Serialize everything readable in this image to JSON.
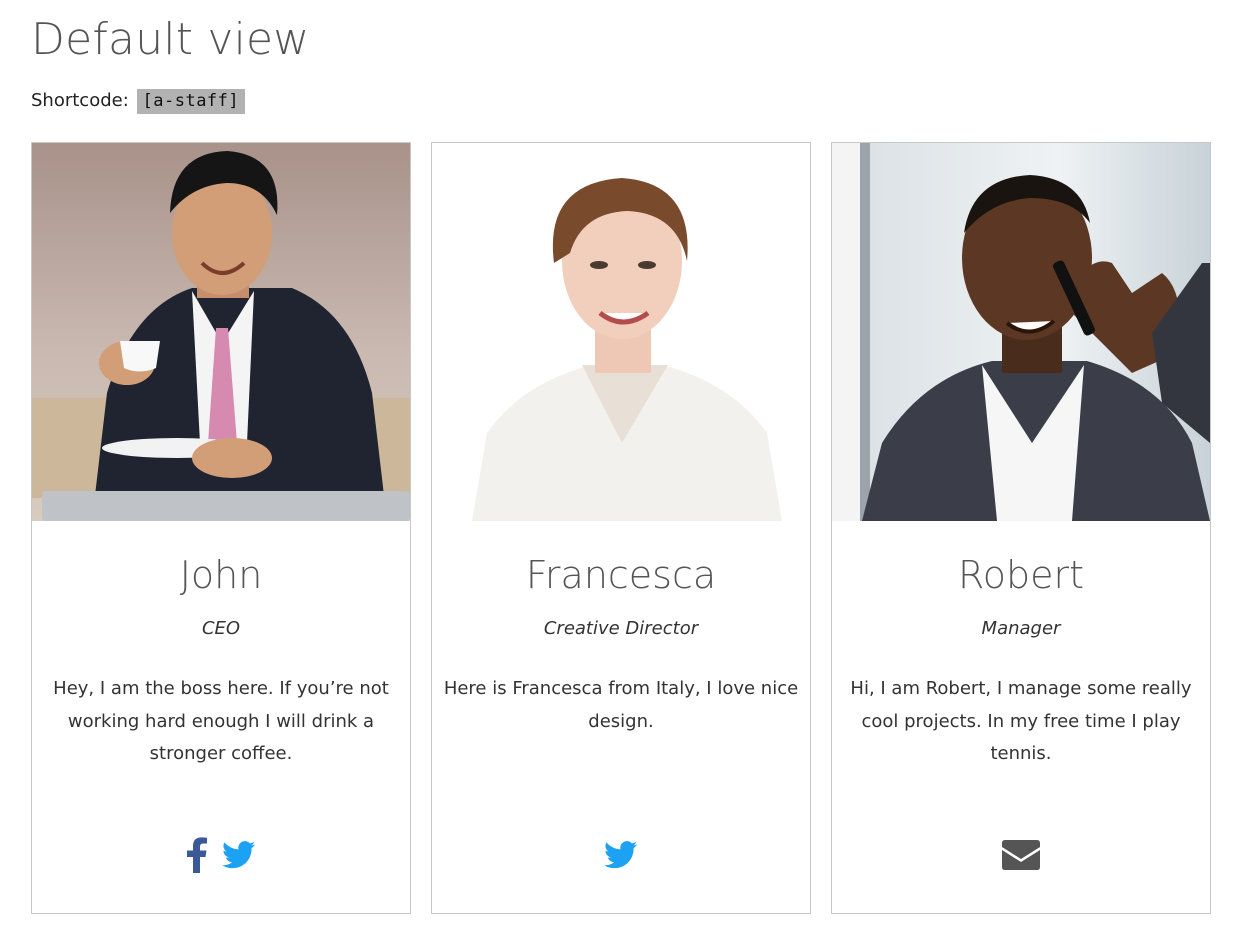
{
  "page": {
    "title": "Default view",
    "shortcode_label": "Shortcode:",
    "shortcode": "[a-staff]"
  },
  "colors": {
    "facebook": "#3b5998",
    "twitter": "#1da1f2",
    "email": "#555555",
    "border": "#c8c8c8"
  },
  "staff": [
    {
      "name": "John",
      "role": "CEO",
      "bio": "Hey, I am the boss here. If you’re not working hard enough I will drink a stronger coffee.",
      "photo_icon": "person-photo",
      "social": [
        "facebook-icon",
        "twitter-icon"
      ]
    },
    {
      "name": "Francesca",
      "role": "Creative Director",
      "bio": "Here is Francesca from Italy, I love nice design.",
      "photo_icon": "person-photo",
      "social": [
        "twitter-icon"
      ]
    },
    {
      "name": "Robert",
      "role": "Manager",
      "bio": "Hi, I am Robert, I manage some really cool projects. In my free time I play tennis.",
      "photo_icon": "person-photo",
      "social": [
        "envelope-icon"
      ]
    }
  ]
}
